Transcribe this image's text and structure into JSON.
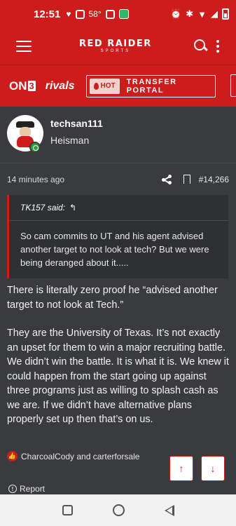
{
  "status_bar": {
    "time": "12:51",
    "temperature": "58°",
    "accent": "#cc1c1c"
  },
  "header": {
    "logo_main": "RED RAIDER",
    "logo_sub": "SPORTS"
  },
  "sub_header": {
    "on3_text": "ON",
    "on3_num": "3",
    "rivals": "rivals",
    "hot": "HOT",
    "transfer_portal": "TRANSFER PORTAL"
  },
  "post": {
    "author": "techsan111",
    "author_title": "Heisman",
    "timestamp": "14 minutes ago",
    "post_number": "#14,266",
    "quote": {
      "author": "TK157 said:",
      "text": "So cam commits to UT and his agent advised another target to not look at tech? But we were being deranged about it....."
    },
    "body_p1": "There is literally zero proof he “advised another target to not look at Tech.”",
    "body_p2": "They are the University of Texas. It’s not exactly an upset for them to win a major recruiting battle. We didn’t win the battle. It is what it is. We knew it could happen from the start going up against three programs just as willing to splash cash as we are. If we didn’t have alternative plans properly set up then that’s on us.",
    "reactions": "CharcoalCody and carterforsale",
    "report": "Report"
  },
  "icons": {
    "up": "↑",
    "down": "↓",
    "reply": "↰",
    "like": "👍"
  }
}
